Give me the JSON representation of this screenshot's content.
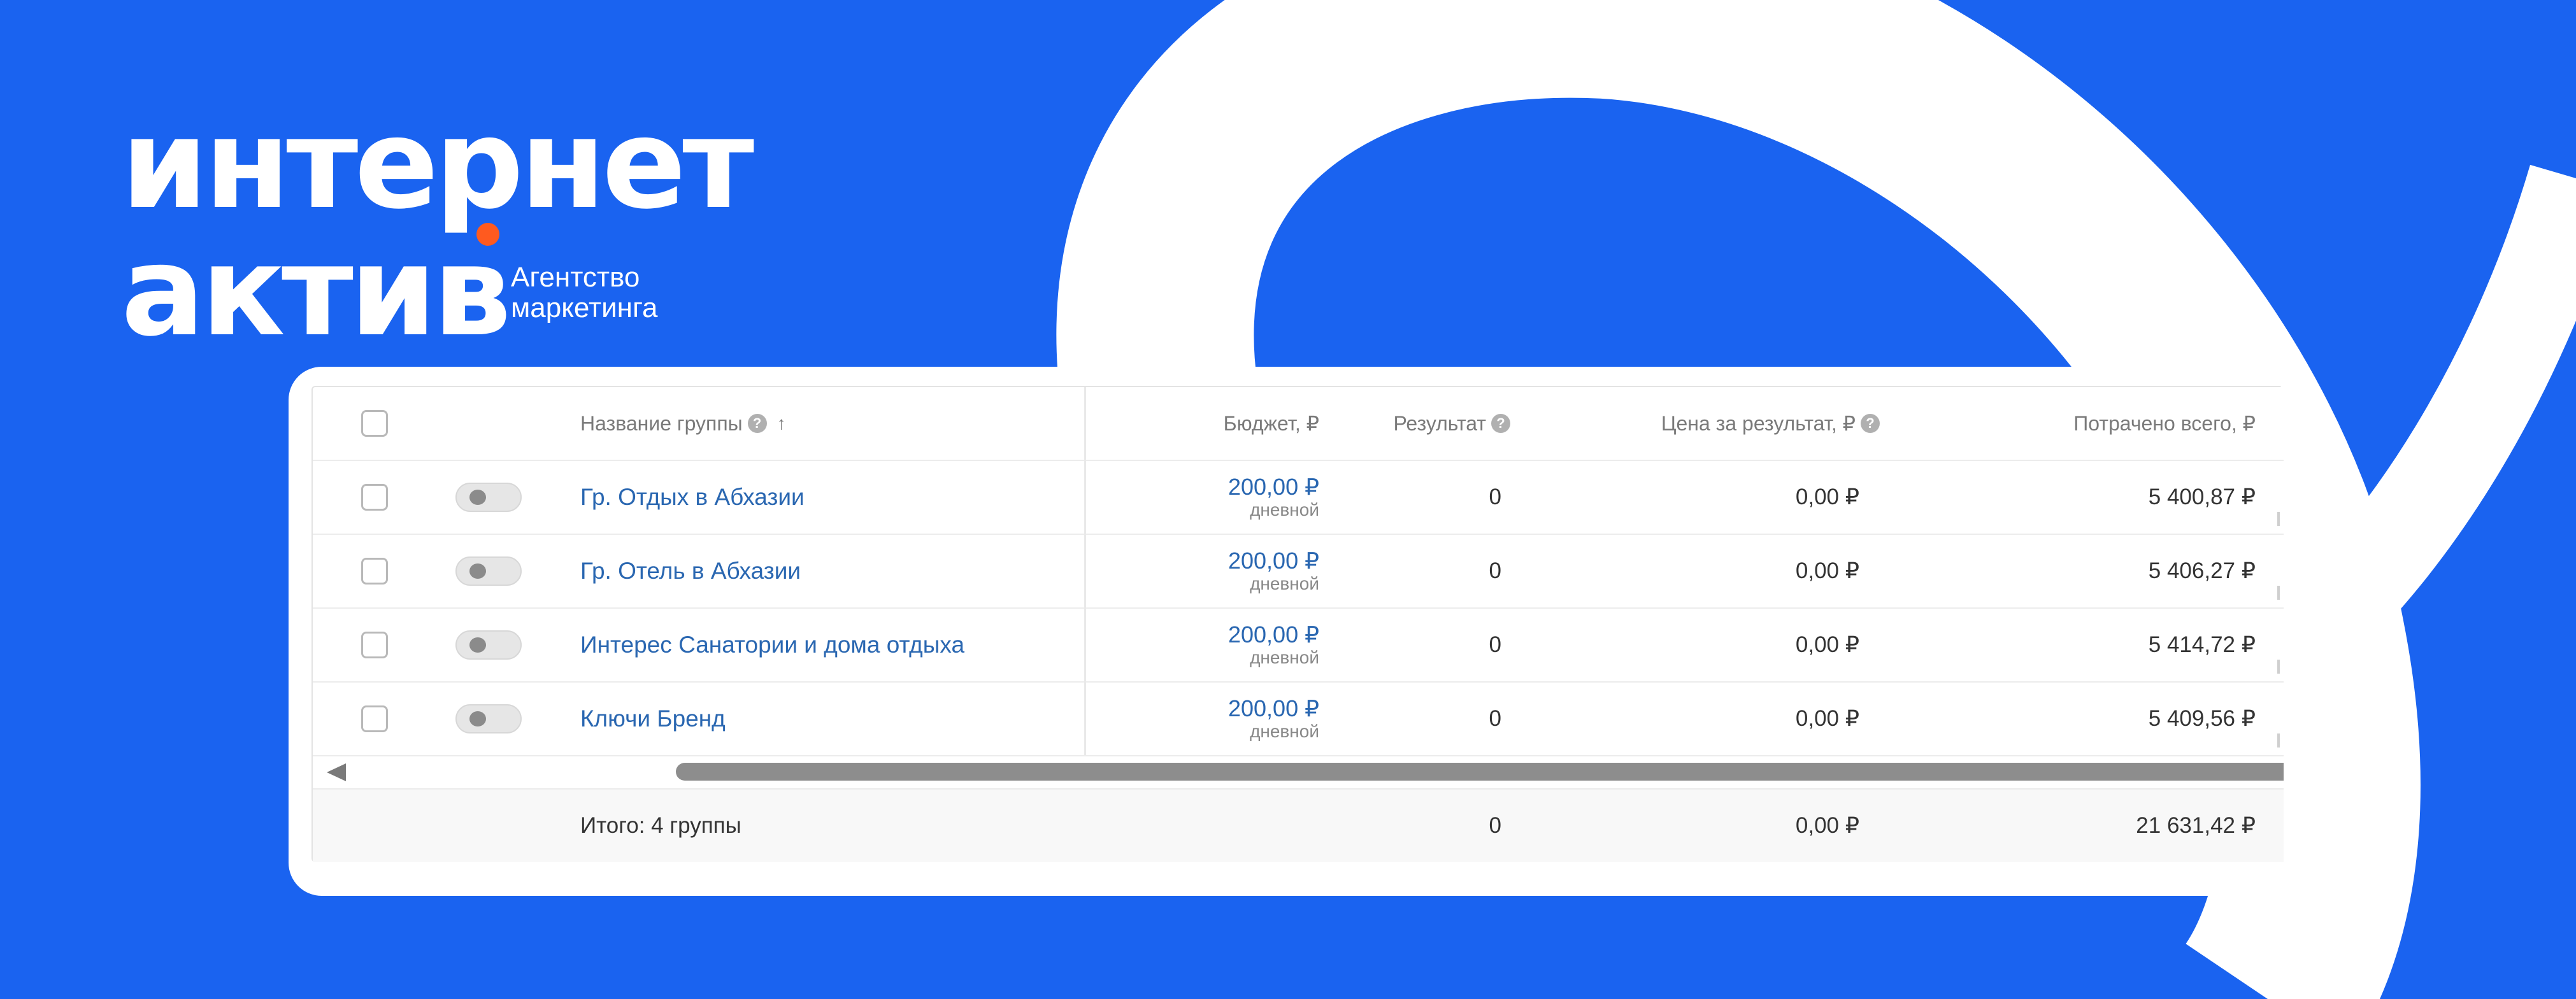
{
  "brand": {
    "logo_line1": "интернет",
    "logo_line2": "актив",
    "subtitle_line1": "Агентство",
    "subtitle_line2": "маркетинга",
    "dot_color": "#ff5a1f",
    "background_color": "#1a63f0"
  },
  "table": {
    "headers": {
      "name": "Название группы",
      "budget": "Бюджет, ₽",
      "result": "Результат",
      "cost_per_result": "Цена за результат, ₽",
      "spent_total": "Потрачено всего, ₽",
      "help_icon": "help-circle-icon",
      "sort_icon": "sort-ascending-icon",
      "sort_glyph": "↑",
      "help_glyph": "?"
    },
    "rows": [
      {
        "name": "Гр. Отдых в Абхазии",
        "budget": "200,00 ₽",
        "budget_period": "дневной",
        "result": "0",
        "cost_per_result": "0,00 ₽",
        "spent_total": "5 400,87 ₽",
        "active": false
      },
      {
        "name": "Гр. Отель в Абхазии",
        "budget": "200,00 ₽",
        "budget_period": "дневной",
        "result": "0",
        "cost_per_result": "0,00 ₽",
        "spent_total": "5 406,27 ₽",
        "active": false
      },
      {
        "name": "Интерес Санатории и дома отдыха",
        "budget": "200,00 ₽",
        "budget_period": "дневной",
        "result": "0",
        "cost_per_result": "0,00 ₽",
        "spent_total": "5 414,72 ₽",
        "active": false
      },
      {
        "name": "Ключи Бренд",
        "budget": "200,00 ₽",
        "budget_period": "дневной",
        "result": "0",
        "cost_per_result": "0,00 ₽",
        "spent_total": "5 409,56 ₽",
        "active": false
      }
    ],
    "footer": {
      "label": "Итого: 4 группы",
      "result": "0",
      "cost_per_result": "0,00 ₽",
      "spent_total": "21 631,42 ₽"
    }
  }
}
